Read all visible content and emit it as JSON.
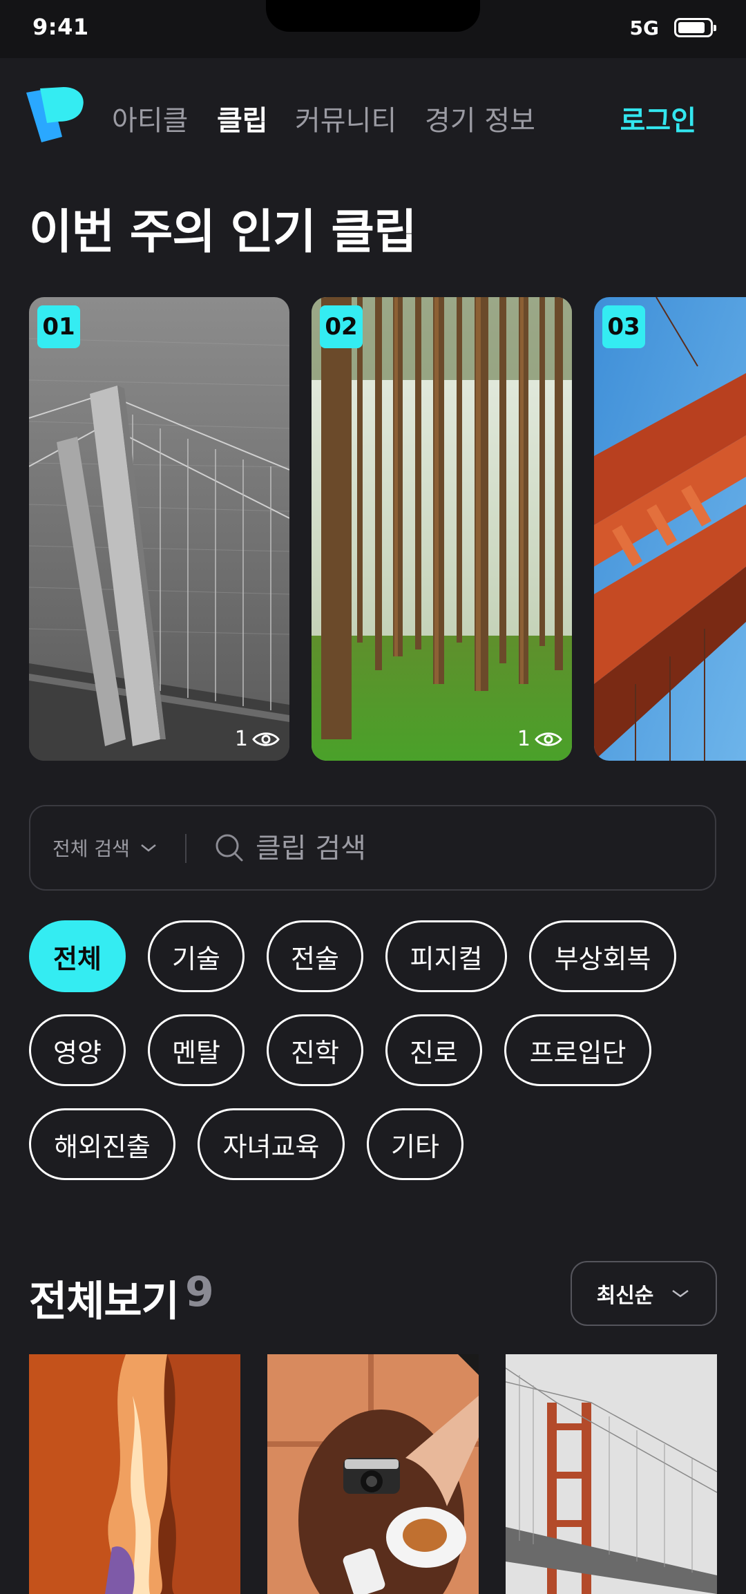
{
  "status": {
    "time": "9:41",
    "network": "5G"
  },
  "nav": {
    "items": [
      "아티클",
      "클립",
      "커뮤니티",
      "경기 정보"
    ],
    "active_index": 1,
    "login_label": "로그인"
  },
  "popular": {
    "title": "이번 주의 인기 클립",
    "cards": [
      {
        "rank": "01",
        "views": "1",
        "image": "aerial-bridge-bw"
      },
      {
        "rank": "02",
        "views": "1",
        "image": "pine-forest"
      },
      {
        "rank": "03",
        "image": "red-bridge-sky"
      }
    ]
  },
  "search": {
    "scope_label": "전체 검색",
    "placeholder": "클립 검색"
  },
  "categories": {
    "items": [
      "전체",
      "기술",
      "전술",
      "피지컬",
      "부상회복",
      "영양",
      "멘탈",
      "진학",
      "진로",
      "프로입단",
      "해외진출",
      "자녀교육",
      "기타"
    ],
    "selected": "전체"
  },
  "all_clips": {
    "title": "전체보기",
    "count": "9",
    "sort_label": "최신순",
    "cards": [
      {
        "image": "canyon"
      },
      {
        "image": "camera-tea-table"
      },
      {
        "image": "foggy-bridge"
      }
    ]
  },
  "colors": {
    "accent": "#34ecf2",
    "background": "#1c1c20"
  }
}
